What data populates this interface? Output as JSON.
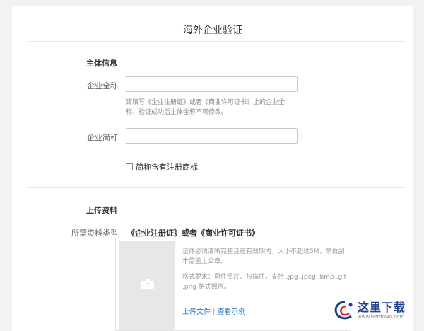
{
  "page": {
    "title": "海外企业验证"
  },
  "subject_info": {
    "section_title": "主体信息",
    "full_name": {
      "label": "企业全称",
      "value": "",
      "hint_line1": "请填写《企业注册证》或者《商业许可证书》上的企业全",
      "hint_line2": "称，验证成功后主体全称不可修改。"
    },
    "short_name": {
      "label": "企业简称",
      "value": ""
    },
    "trademark_checkbox": {
      "label": "简称含有注册商标",
      "checked": false
    }
  },
  "upload": {
    "section_title": "上传资料",
    "material_type_label": "所需资料类型",
    "material_type_value": "《企业注册证》或者《商业许可证书》",
    "desc_line1": "证件必须清晰完整且在有效期内，大小不超过5M，黑白副",
    "desc_line2": "本需盖上公章。",
    "format_line1": "格式要求：原件照片、扫描件，支持 .jpg .jpeg .bmp .gif",
    "format_line2": ".png 格式照片。",
    "upload_link": "上传文件",
    "separator": "|",
    "example_link": "查看示例",
    "icon": "camera-icon"
  },
  "watermark": {
    "text": "这里下载",
    "url": "www.herdown.com"
  }
}
